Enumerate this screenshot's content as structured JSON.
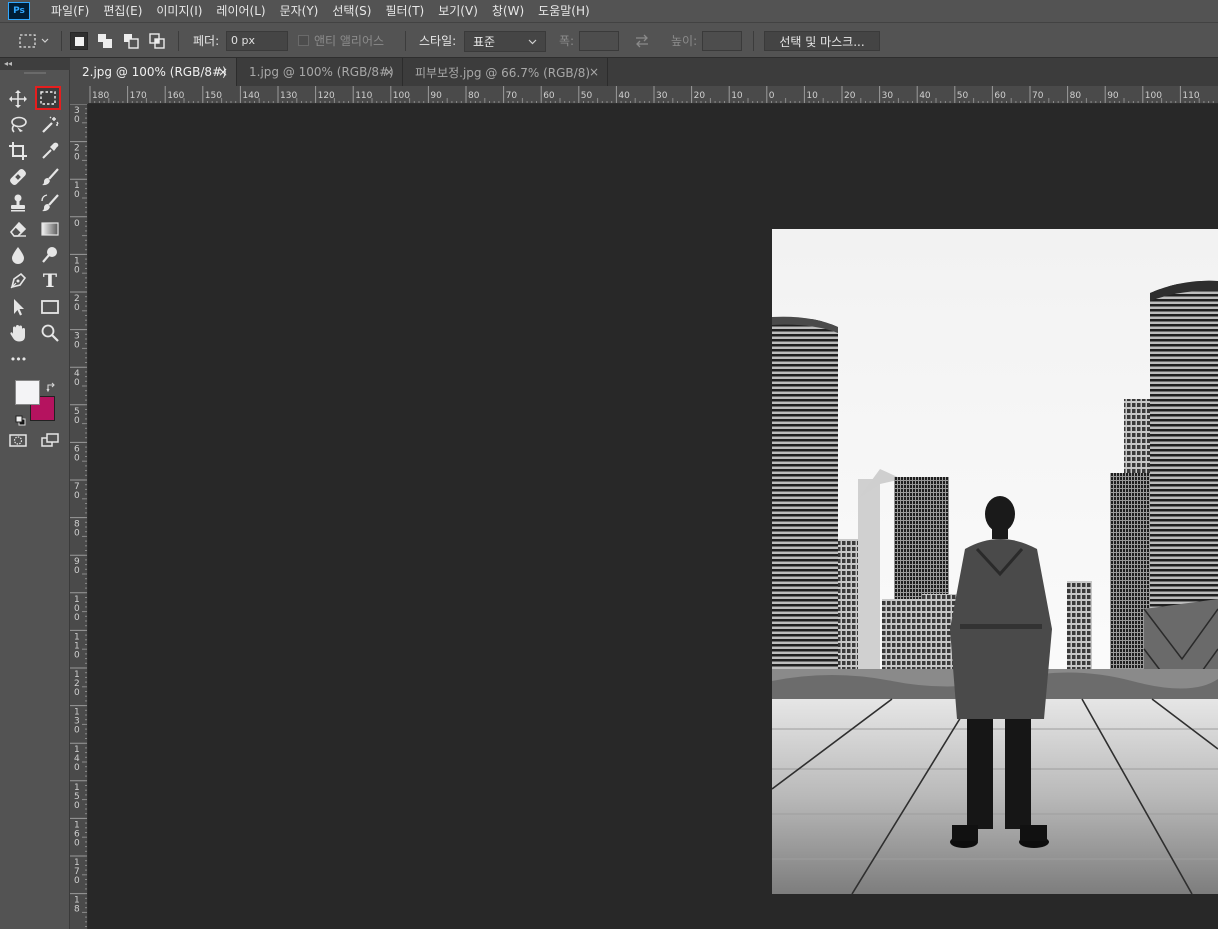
{
  "app": {
    "logo": "Ps"
  },
  "menu": [
    "파일(F)",
    "편집(E)",
    "이미지(I)",
    "레이어(L)",
    "문자(Y)",
    "선택(S)",
    "필터(T)",
    "보기(V)",
    "창(W)",
    "도움말(H)"
  ],
  "options": {
    "feather_label": "페더:",
    "feather_value": "0 px",
    "antialias_label": "앤티 앨리어스",
    "style_label": "스타일:",
    "style_value": "표준",
    "width_label": "폭:",
    "height_label": "높이:",
    "select_mask_button": "선택 및 마스크..."
  },
  "tabs": [
    {
      "label": "2.jpg @ 100% (RGB/8#)",
      "close": "×",
      "active": true
    },
    {
      "label": "1.jpg @ 100% (RGB/8#)",
      "close": "×",
      "active": false
    },
    {
      "label": "피부보정.jpg @ 66.7% (RGB/8)",
      "close": "×",
      "active": false
    }
  ],
  "ruler_h": [
    "180",
    "170",
    "160",
    "150",
    "140",
    "130",
    "120",
    "110",
    "100",
    "90",
    "80",
    "70",
    "60",
    "50",
    "40",
    "30",
    "20",
    "10",
    "0",
    "10",
    "20",
    "30",
    "40",
    "50",
    "60",
    "70",
    "80",
    "90",
    "100",
    "110"
  ],
  "ruler_v": [
    "3\n0",
    "2\n0",
    "1\n0",
    "0",
    "1\n0",
    "2\n0",
    "3\n0",
    "4\n0",
    "5\n0",
    "6\n0",
    "7\n0",
    "8\n0",
    "9\n0",
    "1\n0\n0",
    "1\n1\n0",
    "1\n2\n0",
    "1\n3\n0",
    "1\n4\n0",
    "1\n5\n0",
    "1\n6\n0",
    "1\n7\n0",
    "1\n8"
  ],
  "colors": {
    "foreground": "#f4f4f6",
    "background": "#b5135f",
    "highlight": "#e61e1e"
  },
  "tools": [
    "move-tool-icon",
    "rectangular-marquee-icon",
    "lasso-tool-icon",
    "magic-wand-icon",
    "crop-tool-icon",
    "eyedropper-icon",
    "healing-brush-icon",
    "brush-tool-icon",
    "clone-stamp-icon",
    "history-brush-icon",
    "eraser-icon",
    "gradient-tool-icon",
    "blur-tool-icon",
    "dodge-tool-icon",
    "pen-tool-icon",
    "type-tool-icon",
    "path-selection-icon",
    "rectangle-tool-icon",
    "hand-tool-icon",
    "zoom-tool-icon",
    "more-tools-icon"
  ],
  "type_tool_glyph": "T",
  "more_tools_glyph": "•••"
}
